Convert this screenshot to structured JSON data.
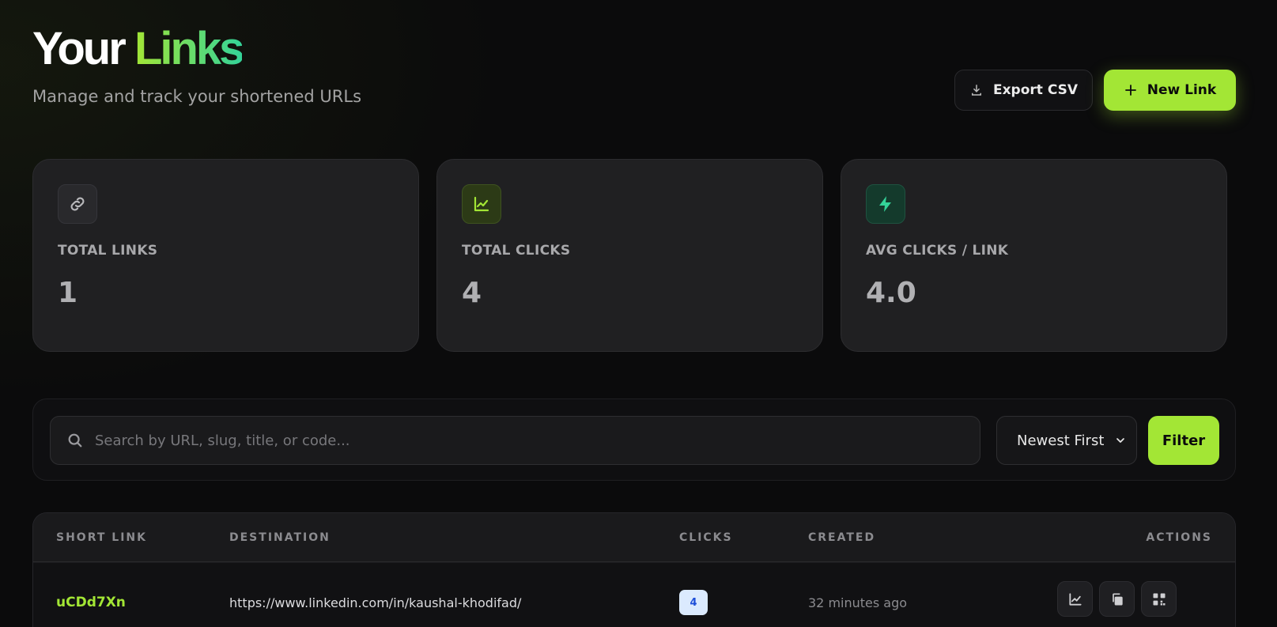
{
  "header": {
    "title_part1": "Your",
    "title_part2": "Links",
    "subtitle": "Manage and track your shortened URLs",
    "export_label": "Export CSV",
    "new_link_label": "New Link"
  },
  "stats": [
    {
      "label": "TOTAL LINKS",
      "value": "1",
      "icon": "link-icon"
    },
    {
      "label": "TOTAL CLICKS",
      "value": "4",
      "icon": "chart-line-icon"
    },
    {
      "label": "AVG CLICKS / LINK",
      "value": "4.0",
      "icon": "bolt-icon"
    }
  ],
  "filters": {
    "search_placeholder": "Search by URL, slug, title, or code...",
    "search_value": "",
    "sort_selected": "Newest First",
    "filter_label": "Filter"
  },
  "table": {
    "columns": [
      "SHORT LINK",
      "DESTINATION",
      "CLICKS",
      "CREATED",
      "ACTIONS"
    ],
    "rows": [
      {
        "slug": "uCDd7Xn",
        "destination": "https://www.linkedin.com/in/kaushal-khodifad/",
        "clicks": "4",
        "created": "32 minutes ago"
      }
    ]
  },
  "colors": {
    "accent": "#a3e635",
    "accent2": "#34d399",
    "background": "#0b0b0c",
    "card": "#202022"
  }
}
